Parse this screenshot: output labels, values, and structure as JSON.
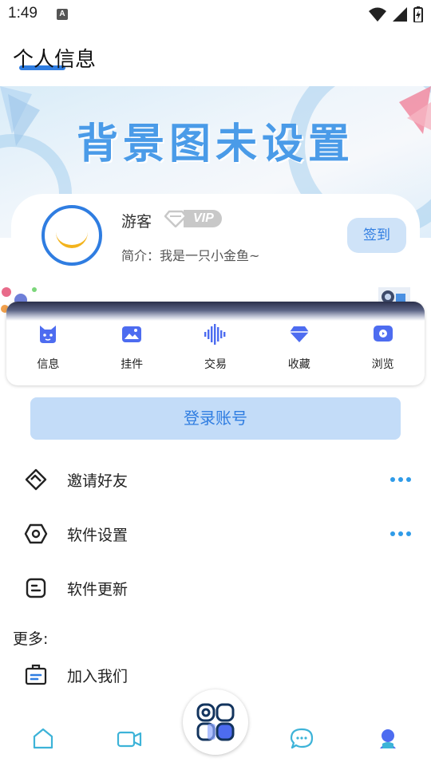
{
  "status_bar": {
    "time": "1:49",
    "notification_letter": "A"
  },
  "header": {
    "title": "个人信息"
  },
  "banner": {
    "title": "背景图未设置"
  },
  "profile": {
    "name": "游客",
    "vip_label": "VIP",
    "bio": "简介：我是一只小金鱼~",
    "signin_label": "签到"
  },
  "quick_menu": [
    {
      "label": "信息",
      "icon": "cat-icon"
    },
    {
      "label": "挂件",
      "icon": "image-icon"
    },
    {
      "label": "交易",
      "icon": "soundwave-icon"
    },
    {
      "label": "收藏",
      "icon": "gem-icon"
    },
    {
      "label": "浏览",
      "icon": "play-icon"
    }
  ],
  "login_label": "登录账号",
  "menu_rows": [
    {
      "label": "邀请好友",
      "icon": "handshake-icon",
      "has_more": true
    },
    {
      "label": "软件设置",
      "icon": "settings-hex-icon",
      "has_more": true
    },
    {
      "label": "软件更新",
      "icon": "update-icon",
      "has_more": false
    }
  ],
  "more_section": {
    "title": "更多:",
    "rows": [
      {
        "label": "加入我们",
        "icon": "inbox-icon"
      }
    ]
  },
  "bottom_nav": [
    {
      "name": "home",
      "icon": "home-icon"
    },
    {
      "name": "video",
      "icon": "video-icon"
    },
    {
      "name": "center",
      "icon": "apps-icon"
    },
    {
      "name": "message",
      "icon": "chat-icon"
    },
    {
      "name": "profile",
      "icon": "user-icon",
      "active": true
    }
  ],
  "colors": {
    "accent": "#2f7de1",
    "light_accent": "#c3dcf8",
    "quick_icon": "#4d6cf0",
    "more_dots": "#2f9be8"
  }
}
